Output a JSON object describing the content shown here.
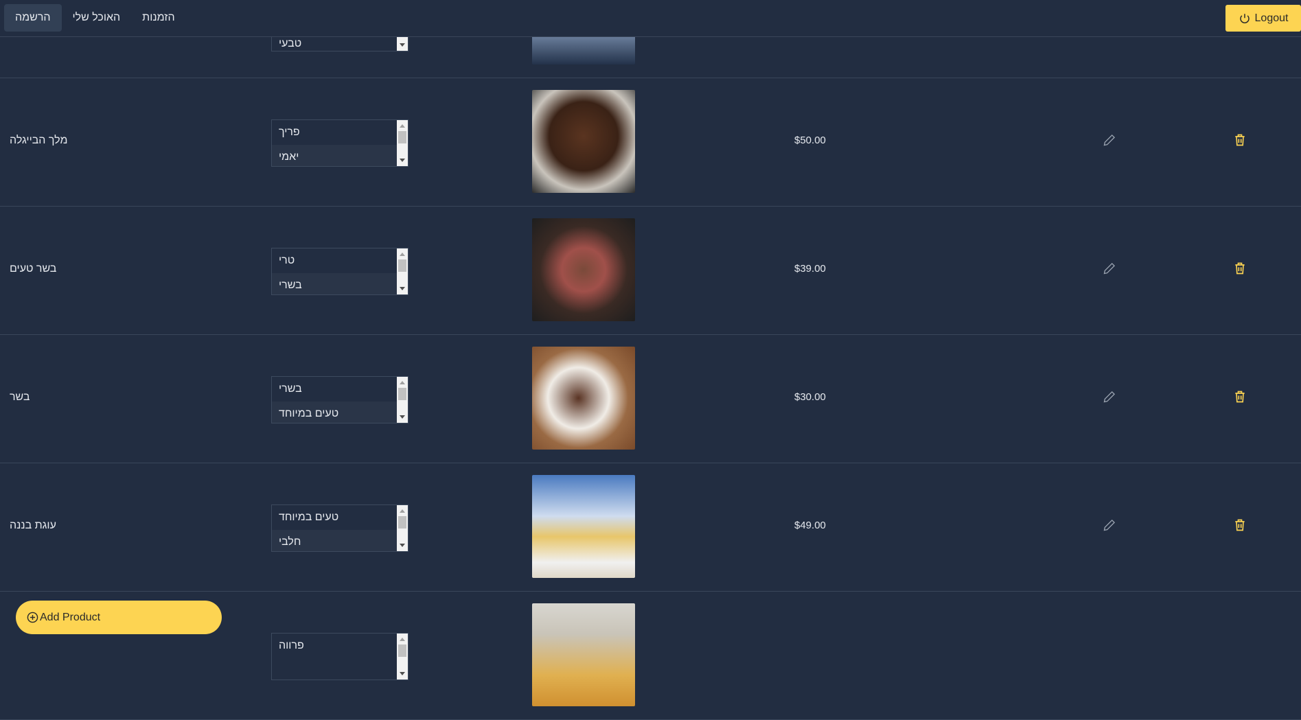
{
  "nav": {
    "items": [
      {
        "label": "הרשמה",
        "active": true
      },
      {
        "label": "האוכל שלי"
      },
      {
        "label": "הזמנות"
      }
    ],
    "logout_label": "Logout"
  },
  "add_product_label": "Add Product",
  "colors": {
    "accent": "#fdd452",
    "background": "#222d41"
  },
  "products": [
    {
      "name": "",
      "tags": [
        "טבעי",
        ""
      ],
      "price": "",
      "image": "food-photo"
    },
    {
      "name": "מלך הבייגלה",
      "tags": [
        "פריך",
        "יאמי"
      ],
      "price": "$50.00",
      "image": "pretzel-chocolate-cake-photo"
    },
    {
      "name": "בשר טעים",
      "tags": [
        "טרי",
        "בשרי"
      ],
      "price": "$39.00",
      "image": "steak-photo"
    },
    {
      "name": "בשר",
      "tags": [
        "בשרי",
        "טעים במיוחד"
      ],
      "price": "$30.00",
      "image": "grilled-steak-plate-photo"
    },
    {
      "name": "עוגת בננה",
      "tags": [
        "טעים במיוחד",
        "חלבי"
      ],
      "price": "$49.00",
      "image": "banana-chips-cake-photo"
    },
    {
      "name": "",
      "tags": [
        "פרווה",
        ""
      ],
      "price": "",
      "image": "french-fries-poster-photo"
    }
  ]
}
